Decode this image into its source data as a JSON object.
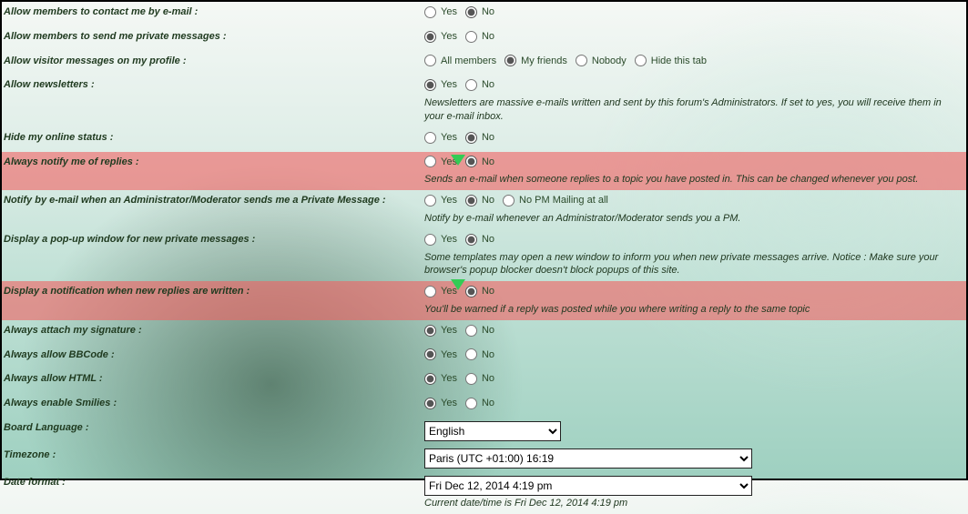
{
  "opt": {
    "yes": "Yes",
    "no": "No"
  },
  "rows": {
    "contact_email": {
      "label": "Allow members to contact me by e-mail :",
      "selected": "no"
    },
    "private_msg": {
      "label": "Allow members to send me private messages :",
      "selected": "yes"
    },
    "visitor_msg": {
      "label": "Allow visitor messages on my profile :",
      "selected": "friends",
      "options": {
        "all": "All members",
        "friends": "My friends",
        "nobody": "Nobody",
        "hide": "Hide this tab"
      }
    },
    "newsletters": {
      "label": "Allow newsletters :",
      "selected": "yes",
      "desc": "Newsletters are massive e-mails written and sent by this forum's Administrators. If set to yes, you will receive them in your e-mail inbox."
    },
    "hide_online": {
      "label": "Hide my online status :",
      "selected": "no"
    },
    "notify_replies": {
      "label": "Always notify me of replies :",
      "selected": "no",
      "desc": "Sends an e-mail when someone replies to a topic you have posted in. This can be changed whenever you post."
    },
    "admin_pm_mail": {
      "label": "Notify by e-mail when an Administrator/Moderator sends me a Private Message :",
      "selected": "no",
      "extra_option": "No PM Mailing at all",
      "desc": "Notify by e-mail whenever an Administrator/Moderator sends you a PM."
    },
    "popup_new_pm": {
      "label": "Display a pop-up window for new private messages :",
      "selected": "no",
      "desc": "Some templates may open a new window to inform you when new private messages arrive. Notice : Make sure your browser's popup blocker doesn't block popups of this site."
    },
    "notif_new_replies": {
      "label": "Display a notification when new replies are written :",
      "selected": "no",
      "desc": "You'll be warned if a reply was posted while you where writing a reply to the same topic"
    },
    "attach_sig": {
      "label": "Always attach my signature :",
      "selected": "yes"
    },
    "allow_bbcode": {
      "label": "Always allow BBCode :",
      "selected": "yes"
    },
    "allow_html": {
      "label": "Always allow HTML :",
      "selected": "yes"
    },
    "enable_smilies": {
      "label": "Always enable Smilies :",
      "selected": "yes"
    },
    "board_lang": {
      "label": "Board Language :",
      "value": "English"
    },
    "timezone": {
      "label": "Timezone :",
      "value": "Paris (UTC +01:00) 16:19"
    },
    "date_format": {
      "label": "Date format :",
      "value": "Fri Dec 12, 2014 4:19 pm",
      "desc": "Current date/time is Fri Dec 12, 2014 4:19 pm"
    }
  }
}
